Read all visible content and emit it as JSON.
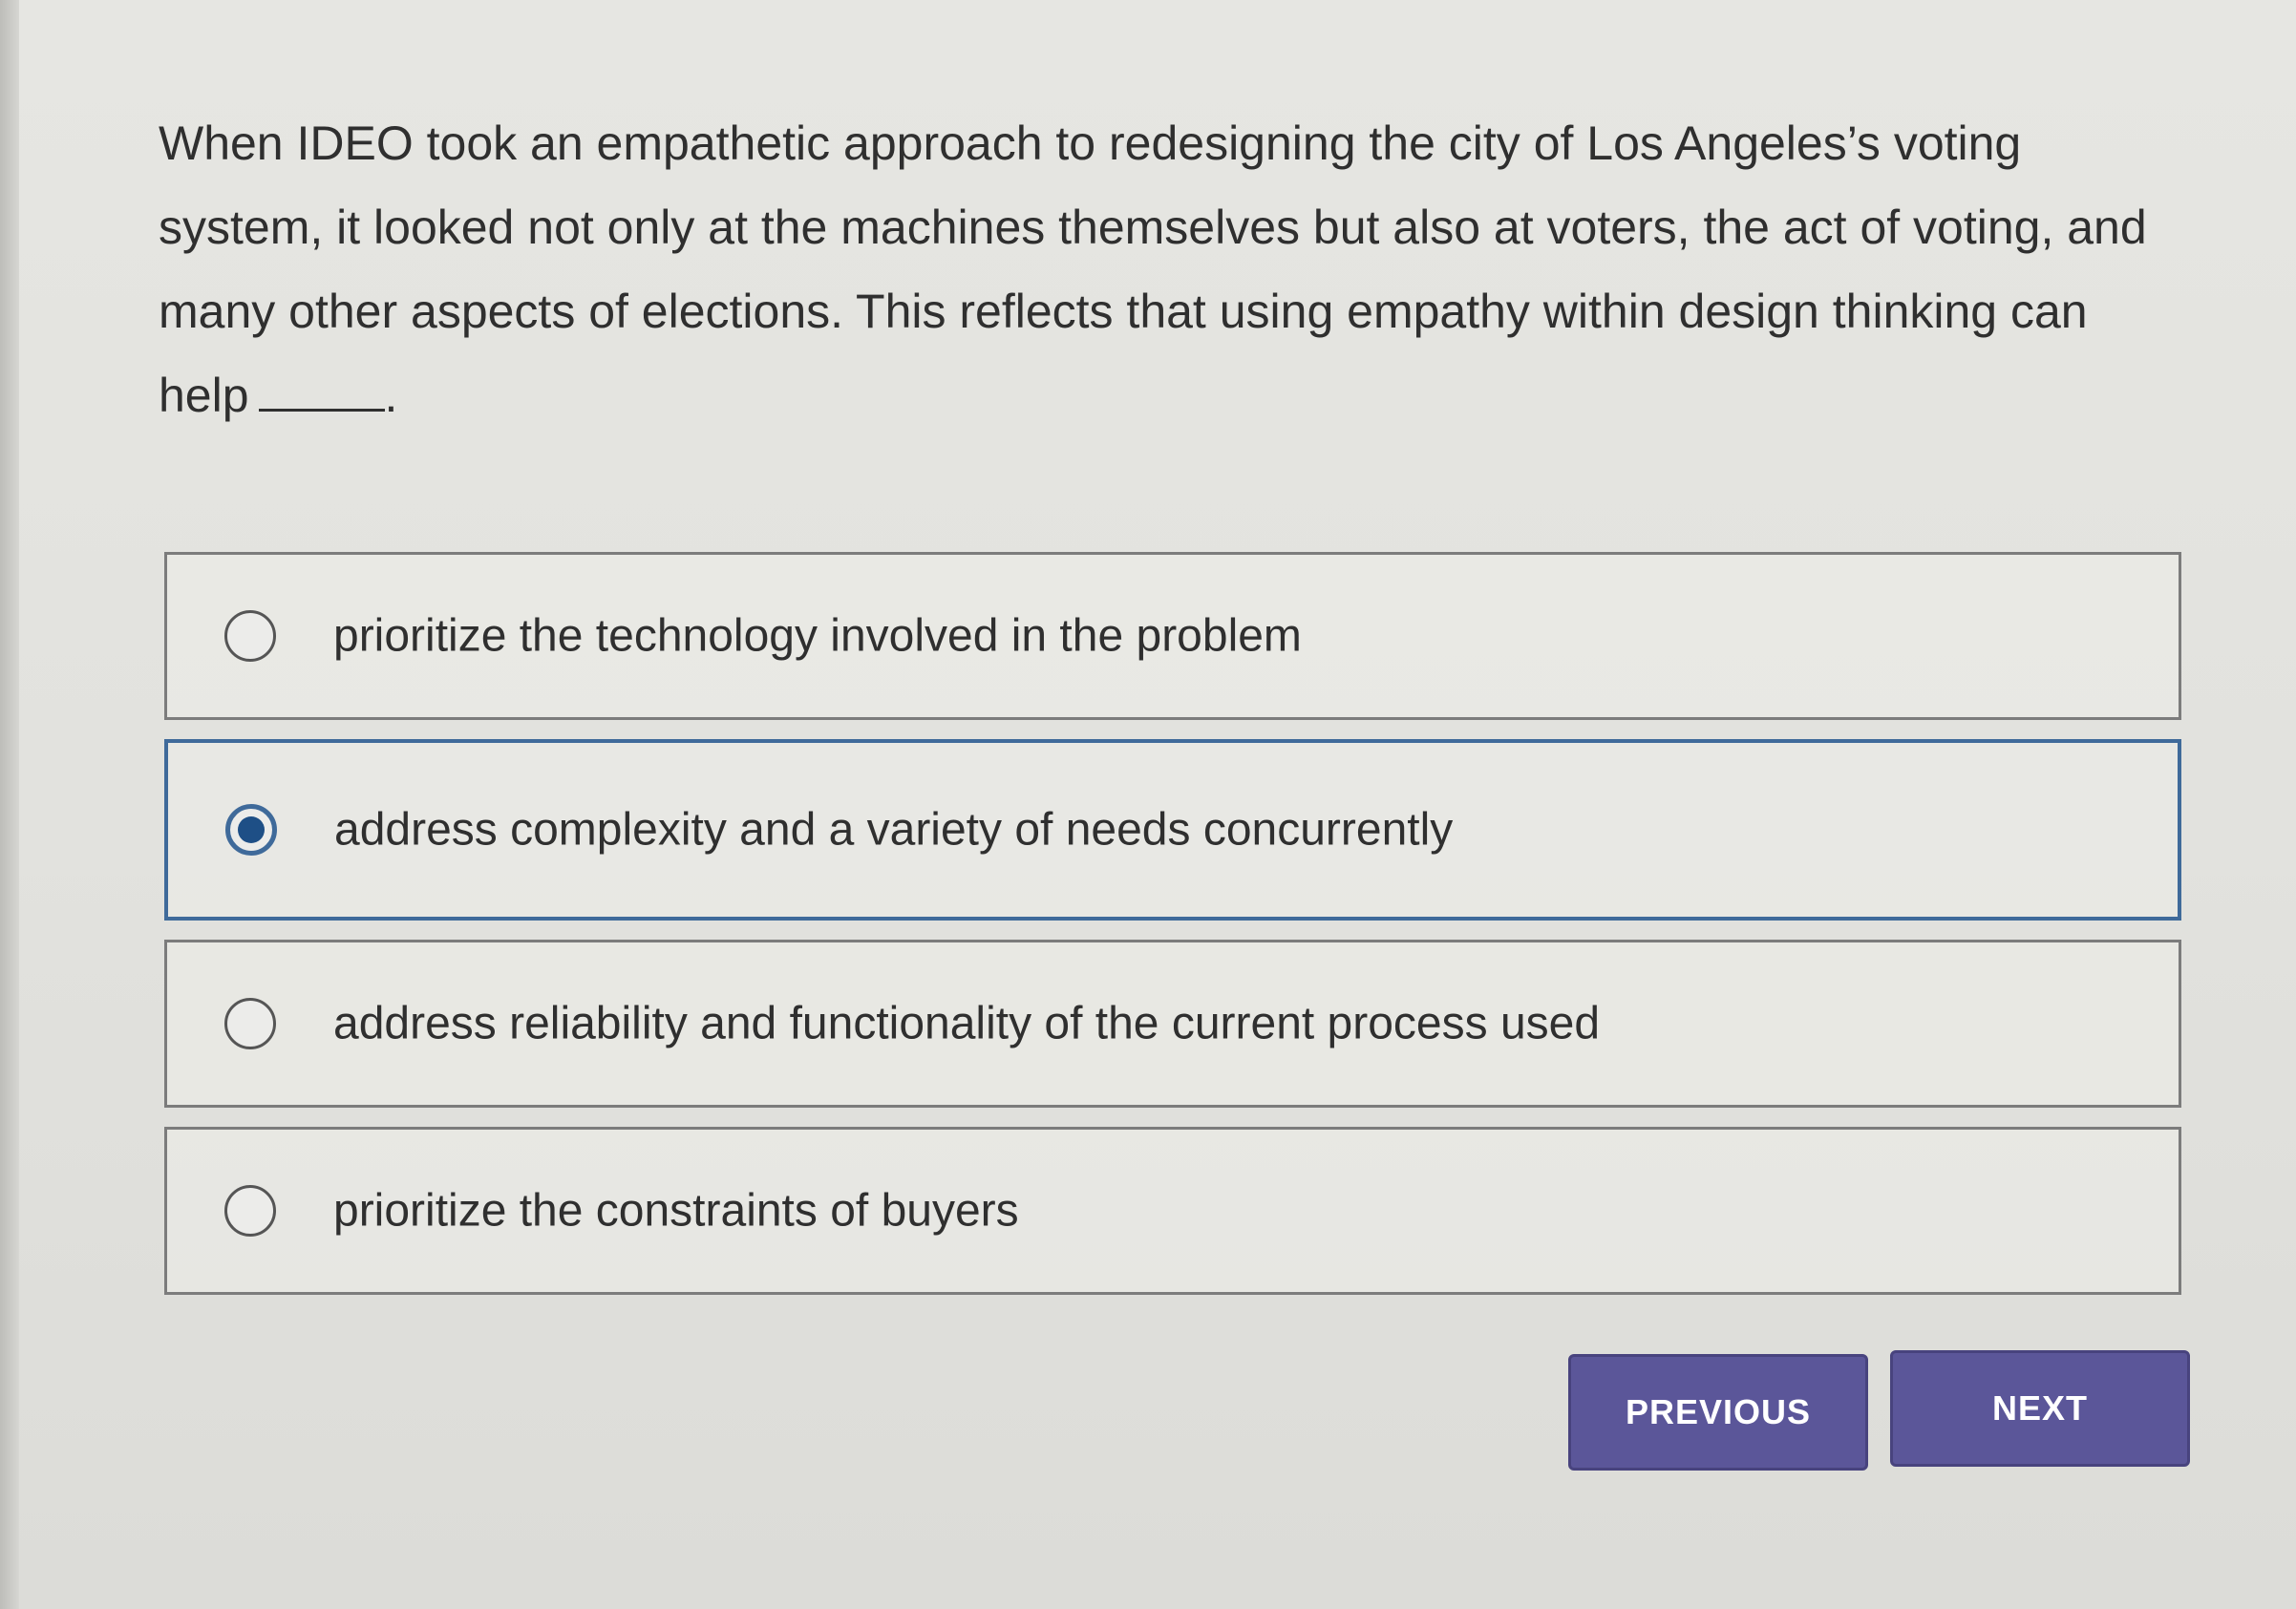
{
  "question": {
    "text": "When IDEO took an empathetic approach to redesigning the city of Los Angeles’s voting system, it looked not only at the machines themselves but also at voters, the act of voting, and many other aspects of elections. This reflects that using empathy within design thinking can help",
    "trailing": "."
  },
  "choices": [
    {
      "label": "prioritize the technology involved in the problem",
      "selected": false
    },
    {
      "label": "address complexity and a variety of needs concurrently",
      "selected": true
    },
    {
      "label": "address reliability and functionality of the current process used",
      "selected": false
    },
    {
      "label": "prioritize the constraints of buyers",
      "selected": false
    }
  ],
  "buttons": {
    "previous": "PREVIOUS",
    "next": "NEXT"
  },
  "colors": {
    "button_bg": "#5b5699",
    "selected_border": "#3f6a9a",
    "radio_fill": "#1e4f86",
    "text": "#2f2f2f"
  }
}
